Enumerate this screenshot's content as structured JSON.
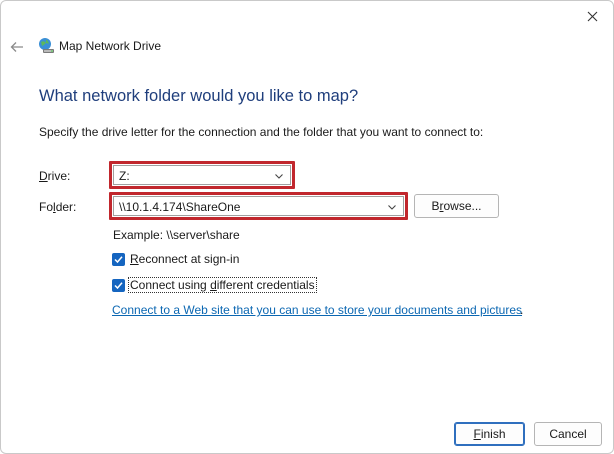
{
  "window": {
    "title": "Map Network Drive"
  },
  "heading": "What network folder would you like to map?",
  "instructions": "Specify the drive letter for the connection and the folder that you want to connect to:",
  "drive": {
    "label_prefix": "D",
    "label_rest": "rive:",
    "value": "Z:"
  },
  "folder": {
    "label_prefix": "Fo",
    "label_underlined": "l",
    "label_rest": "der:",
    "value": "\\\\10.1.4.174\\ShareOne",
    "browse_prefix": "B",
    "browse_underlined": "r",
    "browse_rest": "owse..."
  },
  "example": "Example: \\\\server\\share",
  "options": {
    "reconnect": {
      "underlined": "R",
      "rest": "econnect at sign-in",
      "checked": true
    },
    "different_credentials": {
      "prefix": "Connect using ",
      "underlined": "d",
      "rest": "ifferent credentials",
      "checked": true
    }
  },
  "link": {
    "text": "Connect to a Web site that you can use to store your documents and pictures",
    "suffix": "."
  },
  "buttons": {
    "finish_underlined": "F",
    "finish_rest": "inish",
    "cancel": "Cancel"
  },
  "colors": {
    "heading": "#1f3e7c",
    "highlight": "#c1272d",
    "checkbox": "#1565c0",
    "link": "#0b67b2"
  },
  "icons": {
    "close": "close-icon",
    "back": "back-arrow-icon",
    "app": "network-drive-icon",
    "chevron": "chevron-down-icon"
  }
}
